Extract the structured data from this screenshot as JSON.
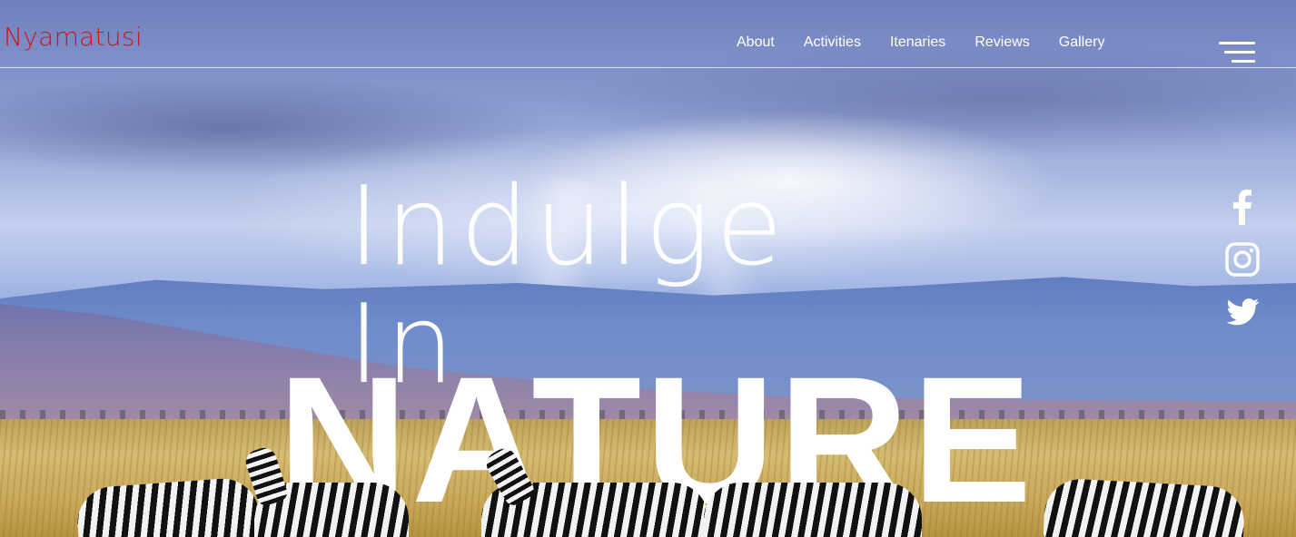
{
  "brand": {
    "name": "Nyamatusi",
    "color": "#d9101b"
  },
  "nav": {
    "links": [
      "About",
      "Activities",
      "Itenaries",
      "Reviews",
      "Gallery"
    ],
    "menu_icon": "hamburger-menu-icon"
  },
  "hero": {
    "subtitle": "Indulge In",
    "title": "NATURE",
    "text_color": "#ffffff"
  },
  "social": {
    "icons": [
      "facebook-icon",
      "instagram-icon",
      "twitter-icon"
    ]
  }
}
